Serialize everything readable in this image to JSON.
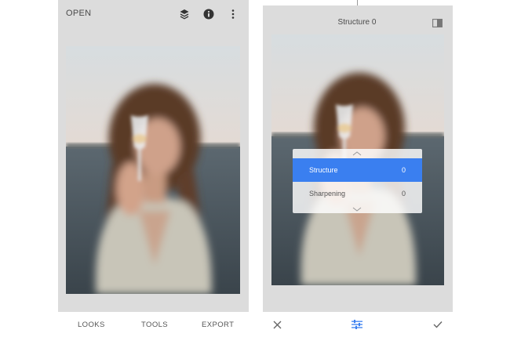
{
  "left_screen": {
    "top_bar": {
      "open_label": "OPEN"
    },
    "bottom_bar": {
      "looks_label": "LOOKS",
      "tools_label": "TOOLS",
      "export_label": "EXPORT"
    }
  },
  "right_screen": {
    "title": "Structure 0",
    "adjust_menu": {
      "items": [
        {
          "label": "Structure",
          "value": "0",
          "selected": true
        },
        {
          "label": "Sharpening",
          "value": "0",
          "selected": false
        }
      ]
    }
  },
  "icons": {
    "layers": "layers-stack-icon",
    "info": "info-icon",
    "more": "more-vertical-icon",
    "compare": "compare-split-icon",
    "cancel": "close-icon",
    "adjust": "sliders-icon",
    "apply": "check-icon"
  },
  "colors": {
    "accent": "#3a7ff0",
    "panel_bg": "#dcdcdc"
  }
}
